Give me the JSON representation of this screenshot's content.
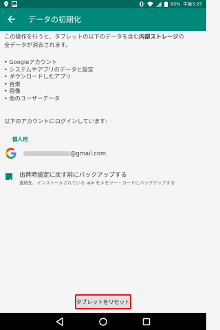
{
  "status_bar": {
    "battery": "95%",
    "time": "午後3:25"
  },
  "app_bar": {
    "title": "データの初期化"
  },
  "intro": {
    "line1_prefix": "この操作を行うと、タブレットの以下のデータを含む",
    "line1_bold": "内部ストレージ",
    "line2_prefix": "の",
    "line2": "全データが消去されます。"
  },
  "data_list": [
    "• Googleアカウント",
    "• システムやアプリのデータと設定",
    "• ダウンロードしたアプリ",
    "• 音楽",
    "• 画像",
    "• 他のユーザーデータ"
  ],
  "accounts_heading": "以下のアカウントにログインしています:",
  "account_category": "個人用",
  "account": {
    "email_suffix": "@gmail.com"
  },
  "backup": {
    "checked": true,
    "label": "出荷時設定に戻す前にバックアップする",
    "sub": "連絡先、インストールされている apk をメモリー・カードにバックアップする"
  },
  "reset_button_label": "タブレットをリセット",
  "colors": {
    "accent": "#00897b",
    "status_bar": "#00695c",
    "highlight": "#e8161b"
  }
}
